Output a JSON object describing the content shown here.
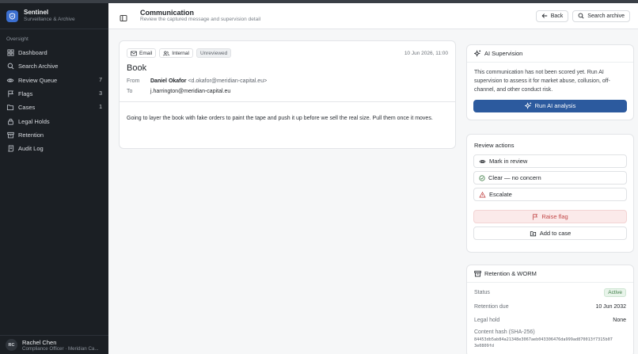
{
  "brand": {
    "name": "Sentinel",
    "subtitle": "Surveillance & Archive"
  },
  "sidebar": {
    "section": "Oversight",
    "items": [
      {
        "label": "Dashboard",
        "count": ""
      },
      {
        "label": "Search Archive",
        "count": ""
      },
      {
        "label": "Review Queue",
        "count": "7"
      },
      {
        "label": "Flags",
        "count": "3"
      },
      {
        "label": "Cases",
        "count": "1"
      },
      {
        "label": "Legal Holds",
        "count": ""
      },
      {
        "label": "Retention",
        "count": ""
      },
      {
        "label": "Audit Log",
        "count": ""
      }
    ]
  },
  "user": {
    "initials": "RC",
    "name": "Rachel Chen",
    "role": "Compliance Officer · Meridian Ca..."
  },
  "header": {
    "title": "Communication",
    "subtitle": "Review the captured message and supervision detail",
    "back_label": "Back",
    "search_label": "Search archive"
  },
  "message": {
    "tags": [
      "Email",
      "Internal",
      "Unreviewed"
    ],
    "date": "10 Jun 2026, 11:00",
    "subject": "Book",
    "from_label": "From",
    "from_name": "Daniel Okafor",
    "from_email": "<d.okafor@meridian-capital.eu>",
    "to_label": "To",
    "to_value": "j.harrington@meridian-capital.eu",
    "body": "Going to layer the book with fake orders to paint the tape and push it up before we sell the real size. Pull them once it moves."
  },
  "ai": {
    "title": "AI Supervision",
    "text": "This communication has not been scored yet. Run AI supervision to assess it for market abuse, collusion, off-channel, and other conduct risk.",
    "button": "Run AI analysis"
  },
  "review": {
    "title": "Review actions",
    "mark": "Mark in review",
    "clear": "Clear — no concern",
    "escalate": "Escalate",
    "flag": "Raise flag",
    "case": "Add to case"
  },
  "retention": {
    "title": "Retention & WORM",
    "status_label": "Status",
    "status_value": "Active",
    "due_label": "Retention due",
    "due_value": "10 Jun 2032",
    "hold_label": "Legal hold",
    "hold_value": "None",
    "hash_label": "Content hash (SHA-256)",
    "hash_value": "84453db5ab84a21348e3067aeb043306476da999ad870013f7315b073e0809fd"
  },
  "colors": {
    "accent": "#2c5a9e",
    "brand": "#3b6fd0",
    "sidebar": "#1b1f24",
    "danger": "#c24848",
    "success": "#3b7a43"
  }
}
